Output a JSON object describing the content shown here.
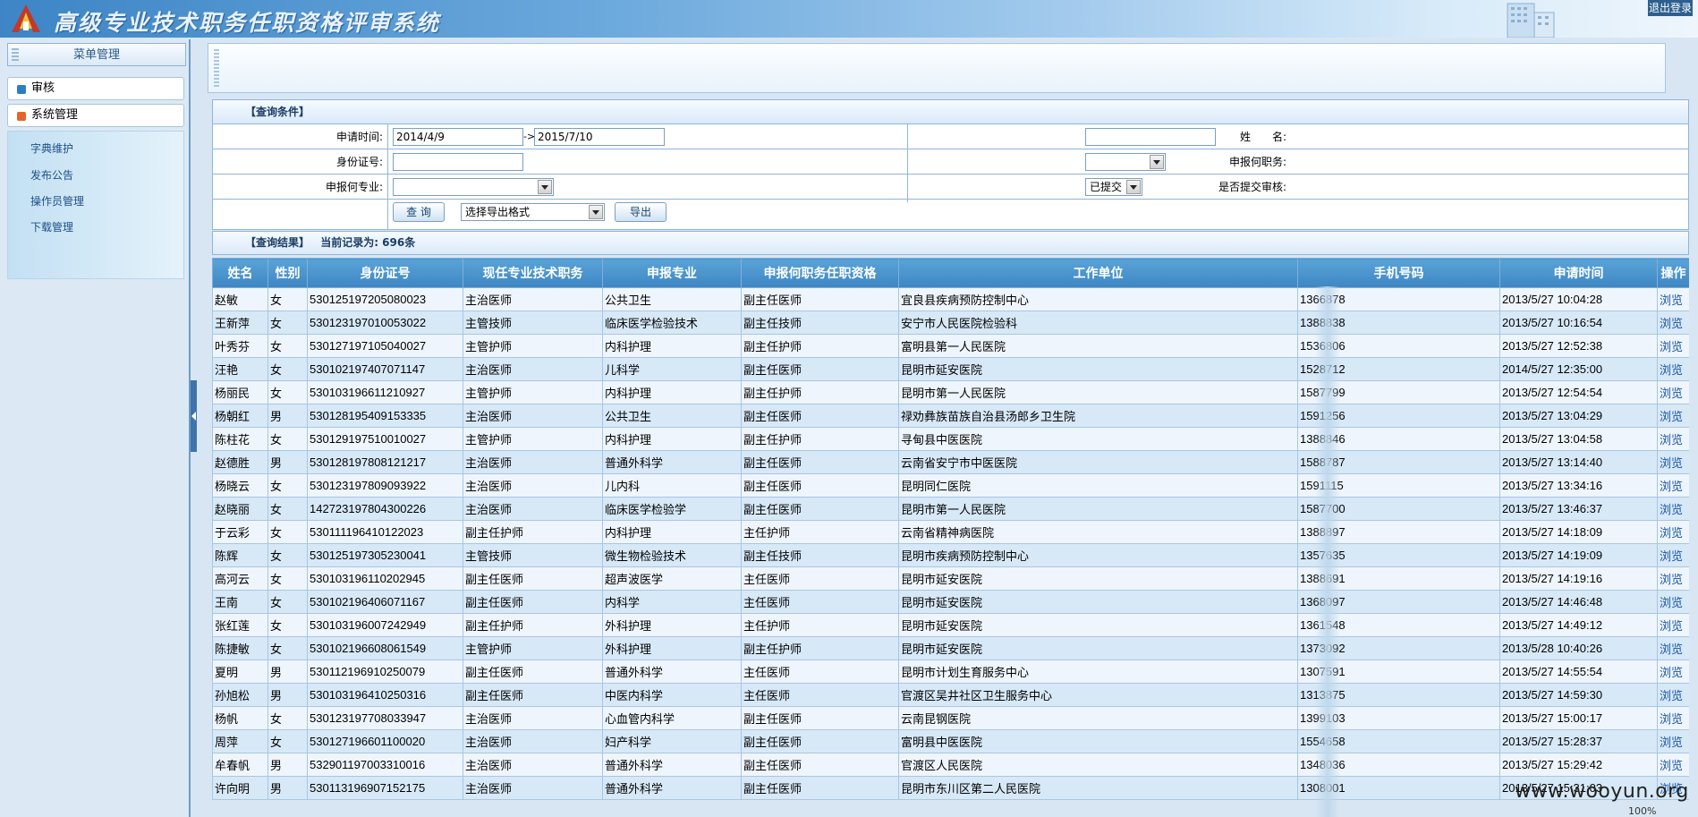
{
  "header": {
    "title": "高级专业技术职务任职资格评审系统",
    "logout_label": "退出登录"
  },
  "sidebar": {
    "title": "菜单管理",
    "groups": [
      {
        "label": "审核"
      },
      {
        "label": "系统管理"
      }
    ],
    "sub_items": [
      {
        "label": "字典维护"
      },
      {
        "label": "发布公告"
      },
      {
        "label": "操作员管理"
      },
      {
        "label": "下载管理"
      }
    ]
  },
  "query": {
    "title": "【查询条件】",
    "date_label": "申请时间:",
    "date_from": "2014/4/9",
    "date_arrow": "->",
    "date_to": "2015/7/10",
    "name_label": "姓　　名:",
    "name_value": "",
    "id_label": "身份证号:",
    "id_value": "",
    "position_label": "申报何职务:",
    "position_value": "",
    "specialty_label": "申报何专业:",
    "specialty_value": "",
    "submitted_label": "是否提交审核:",
    "submitted_value": "已提交",
    "search_button": "查 询",
    "export_format": "选择导出格式",
    "export_button": "导出"
  },
  "results": {
    "title": "【查询结果】",
    "count_text": "当前记录为: 696条",
    "columns": [
      "姓名",
      "性别",
      "身份证号",
      "现任专业技术职务",
      "申报专业",
      "申报何职务任职资格",
      "工作单位",
      "手机号码",
      "申请时间",
      "操作"
    ],
    "rows": [
      [
        "赵敏",
        "女",
        "530125197205080023",
        "主治医师",
        "公共卫生",
        "副主任医师",
        "宜良县疾病预防控制中心",
        "1366878",
        "2013/5/27 10:04:28",
        "浏览"
      ],
      [
        "王新萍",
        "女",
        "530123197010053022",
        "主管技师",
        "临床医学检验技术",
        "副主任技师",
        "安宁市人民医院检验科",
        "1388838",
        "2013/5/27 10:16:54",
        "浏览"
      ],
      [
        "叶秀芬",
        "女",
        "530127197105040027",
        "主管护师",
        "内科护理",
        "副主任护师",
        "富明县第一人民医院",
        "1536806",
        "2013/5/27 12:52:38",
        "浏览"
      ],
      [
        "汪艳",
        "女",
        "530102197407071147",
        "主治医师",
        "儿科学",
        "副主任医师",
        "昆明市延安医院",
        "1528712",
        "2014/5/27 12:35:00",
        "浏览"
      ],
      [
        "杨丽民",
        "女",
        "530103196611210927",
        "主管护师",
        "内科护理",
        "副主任护师",
        "昆明市第一人民医院",
        "1587799",
        "2013/5/27 12:54:54",
        "浏览"
      ],
      [
        "杨朝红",
        "男",
        "530128195409153335",
        "主治医师",
        "公共卫生",
        "副主任医师",
        "禄劝彝族苗族自治县汤郎乡卫生院",
        "1591256",
        "2013/5/27 13:04:29",
        "浏览"
      ],
      [
        "陈柱花",
        "女",
        "530129197510010027",
        "主管护师",
        "内科护理",
        "副主任护师",
        "寻甸县中医医院",
        "1388846",
        "2013/5/27 13:04:58",
        "浏览"
      ],
      [
        "赵德胜",
        "男",
        "530128197808121217",
        "主治医师",
        "普通外科学",
        "副主任医师",
        "云南省安宁市中医医院",
        "1588787",
        "2013/5/27 13:14:40",
        "浏览"
      ],
      [
        "杨晓云",
        "女",
        "530123197809093922",
        "主治医师",
        "儿内科",
        "副主任医师",
        "昆明同仁医院",
        "1591115",
        "2013/5/27 13:34:16",
        "浏览"
      ],
      [
        "赵晓丽",
        "女",
        "142723197804300226",
        "主治医师",
        "临床医学检验学",
        "副主任医师",
        "昆明市第一人民医院",
        "1587700",
        "2013/5/27 13:46:37",
        "浏览"
      ],
      [
        "于云彩",
        "女",
        "530111196410122023",
        "副主任护师",
        "内科护理",
        "主任护师",
        "云南省精神病医院",
        "1388897",
        "2013/5/27 14:18:09",
        "浏览"
      ],
      [
        "陈辉",
        "女",
        "530125197305230041",
        "主管技师",
        "微生物检验技术",
        "副主任技师",
        "昆明市疾病预防控制中心",
        "1357635",
        "2013/5/27 14:19:09",
        "浏览"
      ],
      [
        "高河云",
        "女",
        "530103196110202945",
        "副主任医师",
        "超声波医学",
        "主任医师",
        "昆明市延安医院",
        "1388691",
        "2013/5/27 14:19:16",
        "浏览"
      ],
      [
        "王南",
        "女",
        "530102196406071167",
        "副主任医师",
        "内科学",
        "主任医师",
        "昆明市延安医院",
        "1368097",
        "2013/5/27 14:46:48",
        "浏览"
      ],
      [
        "张红莲",
        "女",
        "530103196007242949",
        "副主任护师",
        "外科护理",
        "主任护师",
        "昆明市延安医院",
        "1361548",
        "2013/5/27 14:49:12",
        "浏览"
      ],
      [
        "陈捷敏",
        "女",
        "530102196608061549",
        "主管护师",
        "外科护理",
        "副主任护师",
        "昆明市延安医院",
        "1373092",
        "2013/5/28 10:40:26",
        "浏览"
      ],
      [
        "夏明",
        "男",
        "530112196910250079",
        "副主任医师",
        "普通外科学",
        "主任医师",
        "昆明市计划生育服务中心",
        "1307591",
        "2013/5/27 14:55:54",
        "浏览"
      ],
      [
        "孙旭松",
        "男",
        "530103196410250316",
        "副主任医师",
        "中医内科学",
        "主任医师",
        "官渡区吴井社区卫生服务中心",
        "1313875",
        "2013/5/27 14:59:30",
        "浏览"
      ],
      [
        "杨帆",
        "女",
        "530123197708033947",
        "主治医师",
        "心血管内科学",
        "副主任医师",
        "云南昆钢医院",
        "1399103",
        "2013/5/27 15:00:17",
        "浏览"
      ],
      [
        "周萍",
        "女",
        "530127196601100020",
        "主治医师",
        "妇产科学",
        "副主任医师",
        "富明县中医医院",
        "1554658",
        "2013/5/27 15:28:37",
        "浏览"
      ],
      [
        "牟春帆",
        "男",
        "532901197003310016",
        "主治医师",
        "普通外科学",
        "副主任医师",
        "官渡区人民医院",
        "1348036",
        "2013/5/27 15:29:42",
        "浏览"
      ],
      [
        "许向明",
        "男",
        "530113196907152175",
        "主治医师",
        "普通外科学",
        "副主任医师",
        "昆明市东川区第二人民医院",
        "1308001",
        "2013/5/27 15:31:03",
        "浏览"
      ]
    ]
  },
  "watermark": "www.wooyun.org",
  "zoom": "100%",
  "colors": {
    "header_blue": "#3d85c6",
    "table_header": "#4a93ce",
    "row_alt": "#d7e8f7",
    "link": "#1a55a8"
  }
}
